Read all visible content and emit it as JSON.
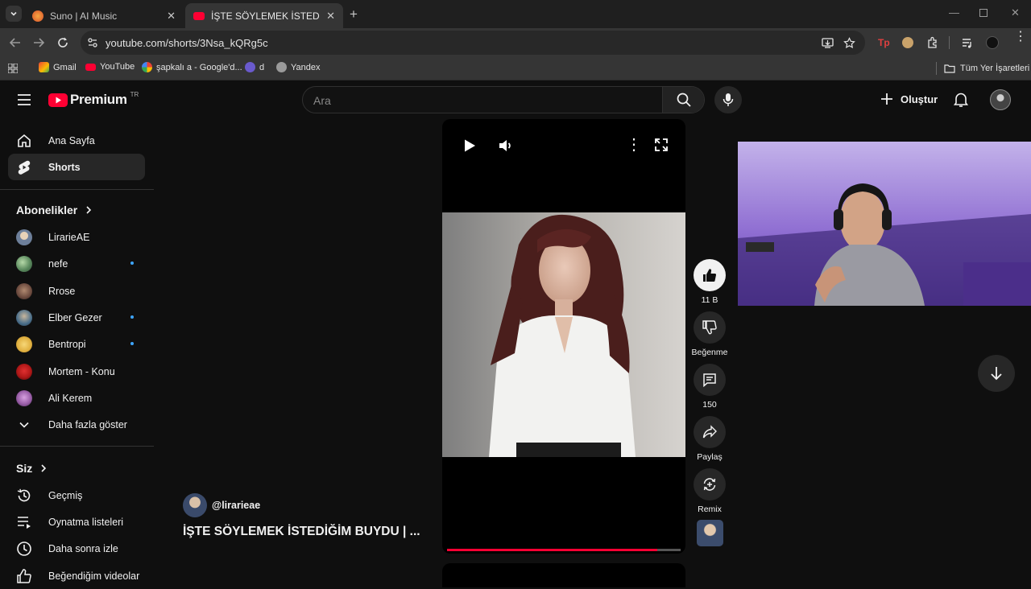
{
  "browser": {
    "tabs": [
      {
        "title": "Suno | AI Music",
        "active": false
      },
      {
        "title": "İŞTE SÖYLEMEK İSTEDİĞİM BUY",
        "active": true
      }
    ],
    "url": "youtube.com/shorts/3Nsa_kQRg5c",
    "bookmarks": [
      {
        "label": "Gmail"
      },
      {
        "label": "YouTube"
      },
      {
        "label": "şapkalı a - Google'd..."
      },
      {
        "label": "d"
      },
      {
        "label": "Yandex"
      }
    ],
    "all_bookmarks_label": "Tüm Yer İşaretleri"
  },
  "header": {
    "logo_text": "Premium",
    "region": "TR",
    "search_placeholder": "Ara",
    "create_label": "Oluştur"
  },
  "sidebar": {
    "main": [
      {
        "label": "Ana Sayfa",
        "icon": "home-icon"
      },
      {
        "label": "Shorts",
        "icon": "shorts-icon",
        "active": true
      }
    ],
    "subscriptions_title": "Abonelikler",
    "subscriptions": [
      {
        "label": "LirarieAE",
        "dot": false,
        "color": "#6d7f9a"
      },
      {
        "label": "nefe",
        "dot": true,
        "color": "#5b8a5e"
      },
      {
        "label": "Rrose",
        "dot": false,
        "color": "#6b4a3e"
      },
      {
        "label": "Elber Gezer",
        "dot": true,
        "color": "#4a6e8a"
      },
      {
        "label": "Bentropi",
        "dot": true,
        "color": "#e0b040"
      },
      {
        "label": "Mortem - Konu",
        "dot": false,
        "color": "#b01818"
      },
      {
        "label": "Ali Kerem",
        "dot": false,
        "color": "#9a5fa8"
      }
    ],
    "show_more_label": "Daha fazla göster",
    "you_title": "Siz",
    "you_items": [
      {
        "label": "Geçmiş",
        "icon": "history-icon"
      },
      {
        "label": "Oynatma listeleri",
        "icon": "playlists-icon"
      },
      {
        "label": "Daha sonra izle",
        "icon": "watch-later-icon"
      },
      {
        "label": "Beğendiğim videolar",
        "icon": "liked-videos-icon"
      }
    ]
  },
  "short": {
    "channel": "@lirarieae",
    "title": "İŞTE SÖYLEMEK İSTEDİĞİM BUYDU | ...",
    "progress": 0.9,
    "actions": {
      "likes": "11 B",
      "dislike_label": "Beğenme",
      "comments": "150",
      "share_label": "Paylaş",
      "remix_label": "Remix"
    }
  }
}
